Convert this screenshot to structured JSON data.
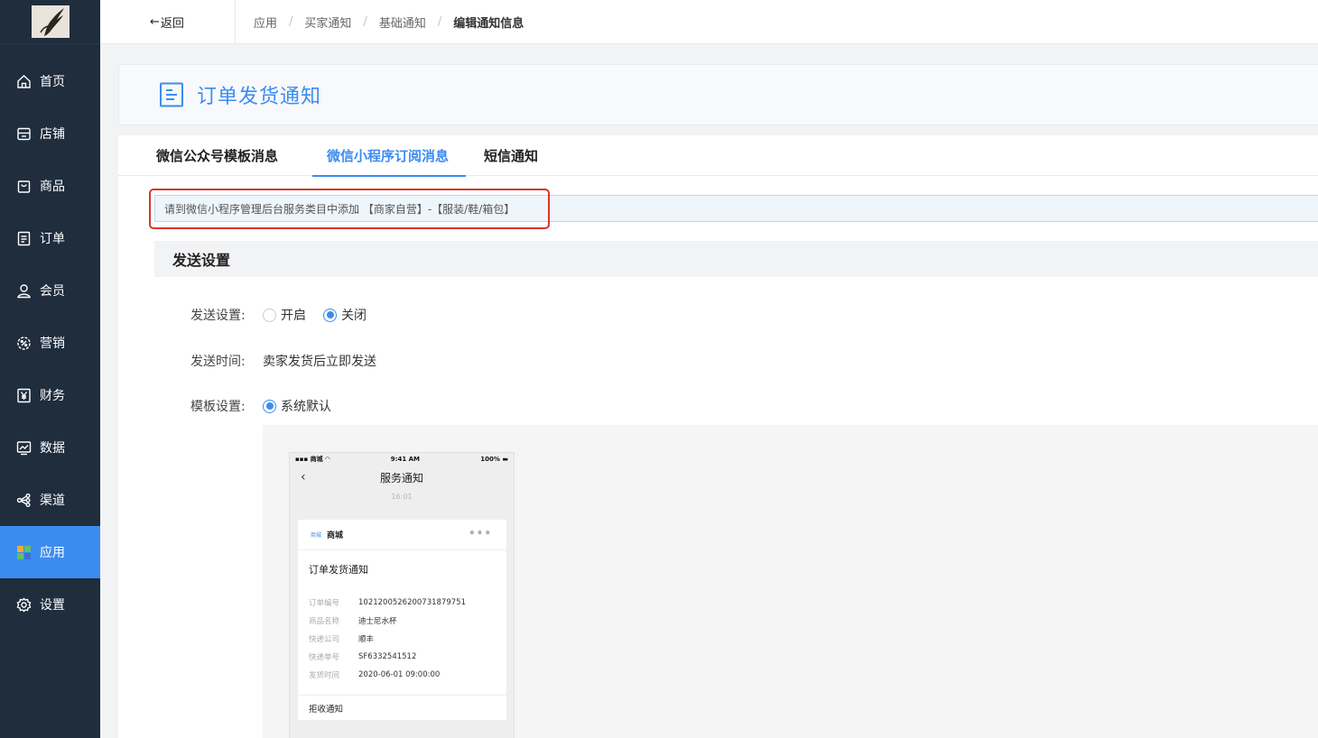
{
  "sidebar": {
    "items": [
      {
        "label": "首页",
        "icon": "home-icon"
      },
      {
        "label": "店铺",
        "icon": "store-icon"
      },
      {
        "label": "商品",
        "icon": "bag-icon"
      },
      {
        "label": "订单",
        "icon": "order-icon"
      },
      {
        "label": "会员",
        "icon": "user-icon"
      },
      {
        "label": "营销",
        "icon": "marketing-icon"
      },
      {
        "label": "财务",
        "icon": "yen-icon"
      },
      {
        "label": "数据",
        "icon": "chart-icon"
      },
      {
        "label": "渠道",
        "icon": "share-icon"
      },
      {
        "label": "应用",
        "icon": "apps-icon",
        "active": true
      },
      {
        "label": "设置",
        "icon": "gear-icon"
      }
    ]
  },
  "topbar": {
    "back_label": "返回",
    "breadcrumb": [
      "应用",
      "买家通知",
      "基础通知",
      "编辑通知信息"
    ]
  },
  "header": {
    "title": "订单发货通知"
  },
  "tabs": [
    "微信公众号模板消息",
    "微信小程序订阅消息",
    "短信通知"
  ],
  "notice": "请到微信小程序管理后台服务类目中添加 【商家自营】-【服装/鞋/箱包】",
  "section_title": "发送设置",
  "form": {
    "send_label": "发送设置:",
    "send_on": "开启",
    "send_off": "关闭",
    "time_label": "发送时间:",
    "time_value": "卖家发货后立即发送",
    "template_label": "模板设置:",
    "template_option": "系统默认"
  },
  "phone": {
    "carrier": "商城",
    "time": "9:41 AM",
    "battery": "100%",
    "nav_title": "服务通知",
    "msg_time": "16:01",
    "app_badge": "商城",
    "app_name": "商城",
    "card_title": "订单发货通知",
    "fields": [
      {
        "k": "订单编号",
        "v": "1021200526200731879751"
      },
      {
        "k": "商品名称",
        "v": "迪士尼水杯"
      },
      {
        "k": "快递公司",
        "v": "顺丰"
      },
      {
        "k": "快递单号",
        "v": "SF6332541512"
      },
      {
        "k": "发货时间",
        "v": "2020-06-01 09:00:00"
      }
    ],
    "footer": "拒收通知"
  },
  "colors": {
    "accent": "#3c8cf0",
    "sidebar": "#1f2d3d",
    "highlight": "#d9352a"
  }
}
